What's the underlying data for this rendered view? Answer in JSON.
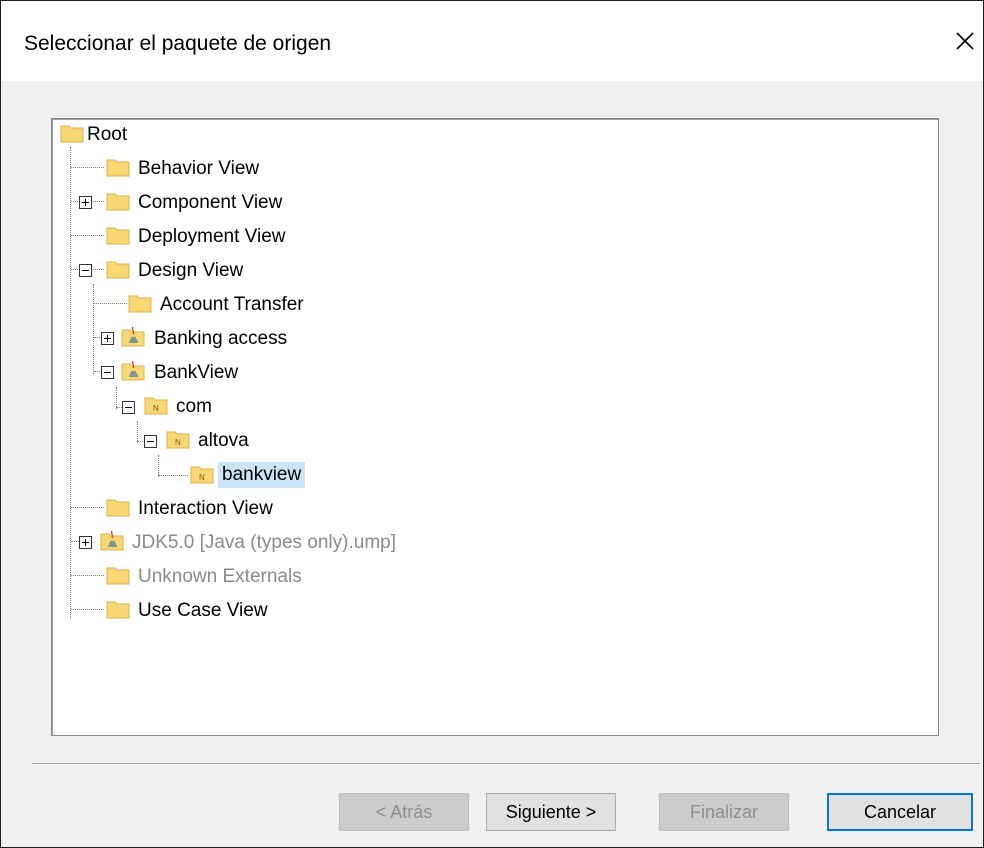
{
  "dialog": {
    "title": "Seleccionar el paquete de origen"
  },
  "tree": {
    "nodes": [
      {
        "label": "Root",
        "icon": "folder-icon"
      },
      {
        "label": "Behavior View",
        "icon": "folder-icon"
      },
      {
        "label": "Component View",
        "icon": "folder-icon",
        "expander": "plus"
      },
      {
        "label": "Deployment View",
        "icon": "folder-icon"
      },
      {
        "label": "Design View",
        "icon": "folder-icon",
        "expander": "minus"
      },
      {
        "label": "Account Transfer",
        "icon": "folder-icon"
      },
      {
        "label": "Banking access",
        "icon": "java-package-icon",
        "expander": "plus"
      },
      {
        "label": "BankView",
        "icon": "java-package-icon",
        "expander": "minus"
      },
      {
        "label": "com",
        "icon": "namespace-folder-icon",
        "expander": "minus"
      },
      {
        "label": "altova",
        "icon": "namespace-folder-icon",
        "expander": "minus"
      },
      {
        "label": "bankview",
        "icon": "namespace-folder-icon",
        "selected": true
      },
      {
        "label": "Interaction View",
        "icon": "folder-icon"
      },
      {
        "label": "JDK5.0 [Java (types only).ump]",
        "icon": "java-package-icon",
        "expander": "plus",
        "dimmed": true
      },
      {
        "label": "Unknown Externals",
        "icon": "folder-icon",
        "dimmed": true
      },
      {
        "label": "Use Case View",
        "icon": "folder-icon"
      }
    ]
  },
  "buttons": {
    "back": "< Atrás",
    "next": "Siguiente >",
    "finish": "Finalizar",
    "cancel": "Cancelar"
  },
  "colors": {
    "folder": "#f8d775",
    "selection": "#cce4f7",
    "default_button_border": "#0078d7"
  }
}
